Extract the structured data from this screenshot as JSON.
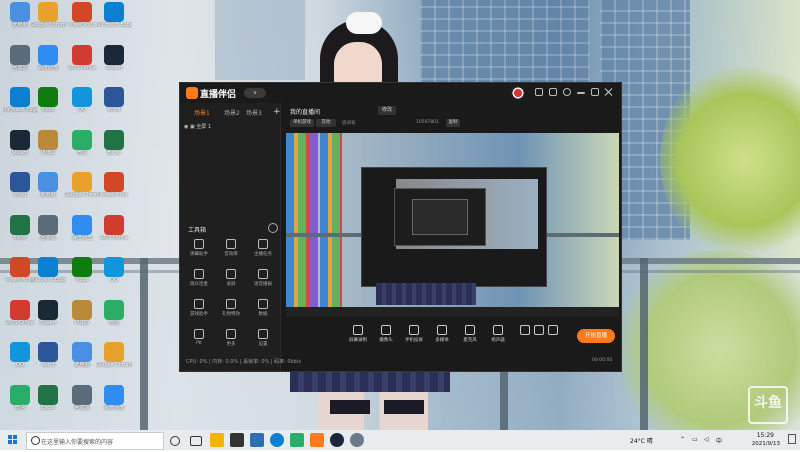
{
  "desktop_icons": [
    {
      "label": "此电脑",
      "color": "#4a90e2"
    },
    {
      "label": "回收站",
      "color": "#5b6b7a"
    },
    {
      "label": "Microsoft Edge",
      "color": "#0b7fd0"
    },
    {
      "label": "Steam",
      "color": "#1b2838"
    },
    {
      "label": "Word",
      "color": "#2b579a"
    },
    {
      "label": "Excel",
      "color": "#217346"
    },
    {
      "label": "PowerPoint",
      "color": "#d24726"
    },
    {
      "label": "WPS Office",
      "color": "#d23b2f"
    },
    {
      "label": "QQ",
      "color": "#1296db"
    },
    {
      "label": "微信",
      "color": "#2aae67"
    },
    {
      "label": "Google Chrome",
      "color": "#e8a12a"
    },
    {
      "label": "百度网盘",
      "color": "#2f8cf0"
    },
    {
      "label": "Xbox",
      "color": "#107c10"
    },
    {
      "label": "PUBG",
      "color": "#b88a3a"
    }
  ],
  "taskbar": {
    "search_placeholder": "在这里输入你要搜索的内容",
    "weather": "24°C 晴",
    "time": "15:29",
    "date": "2021/9/13"
  },
  "app": {
    "title": "直播伴侣",
    "version_badge": "v",
    "left_tabs": [
      "场景1",
      "场景2",
      "场景3"
    ],
    "scene_label": "全屏 1",
    "toolbox_title": "工具箱",
    "tools": [
      {
        "label": "弹幕助手"
      },
      {
        "label": "音效库"
      },
      {
        "label": "主播任务"
      },
      {
        "label": "观众连麦"
      },
      {
        "label": "录屏"
      },
      {
        "label": "语音播报"
      },
      {
        "label": "游戏助手"
      },
      {
        "label": "礼物特效"
      },
      {
        "label": "数据"
      },
      {
        "label": "PK"
      },
      {
        "label": "更多"
      },
      {
        "label": "设置"
      }
    ],
    "status_line": "CPU: 0% | 内存: 0.0% | 丢帧率: 0% | 码率: 0kb/s",
    "stream_title": "我的直播间",
    "edit_label": "修改",
    "category": "单机游戏",
    "sub_category": "其他",
    "room_info": "房间号",
    "room_id": "10507801",
    "copy_label": "复制",
    "bottom_tools": [
      {
        "label": "屏幕录制"
      },
      {
        "label": "摄像头"
      },
      {
        "label": "手机投屏"
      },
      {
        "label": "多媒体"
      },
      {
        "label": "麦克风"
      },
      {
        "label": "扬声器"
      }
    ],
    "start_live_label": "开始直播",
    "live_timer": "00:00:00"
  },
  "watermark_text": "斗鱼"
}
